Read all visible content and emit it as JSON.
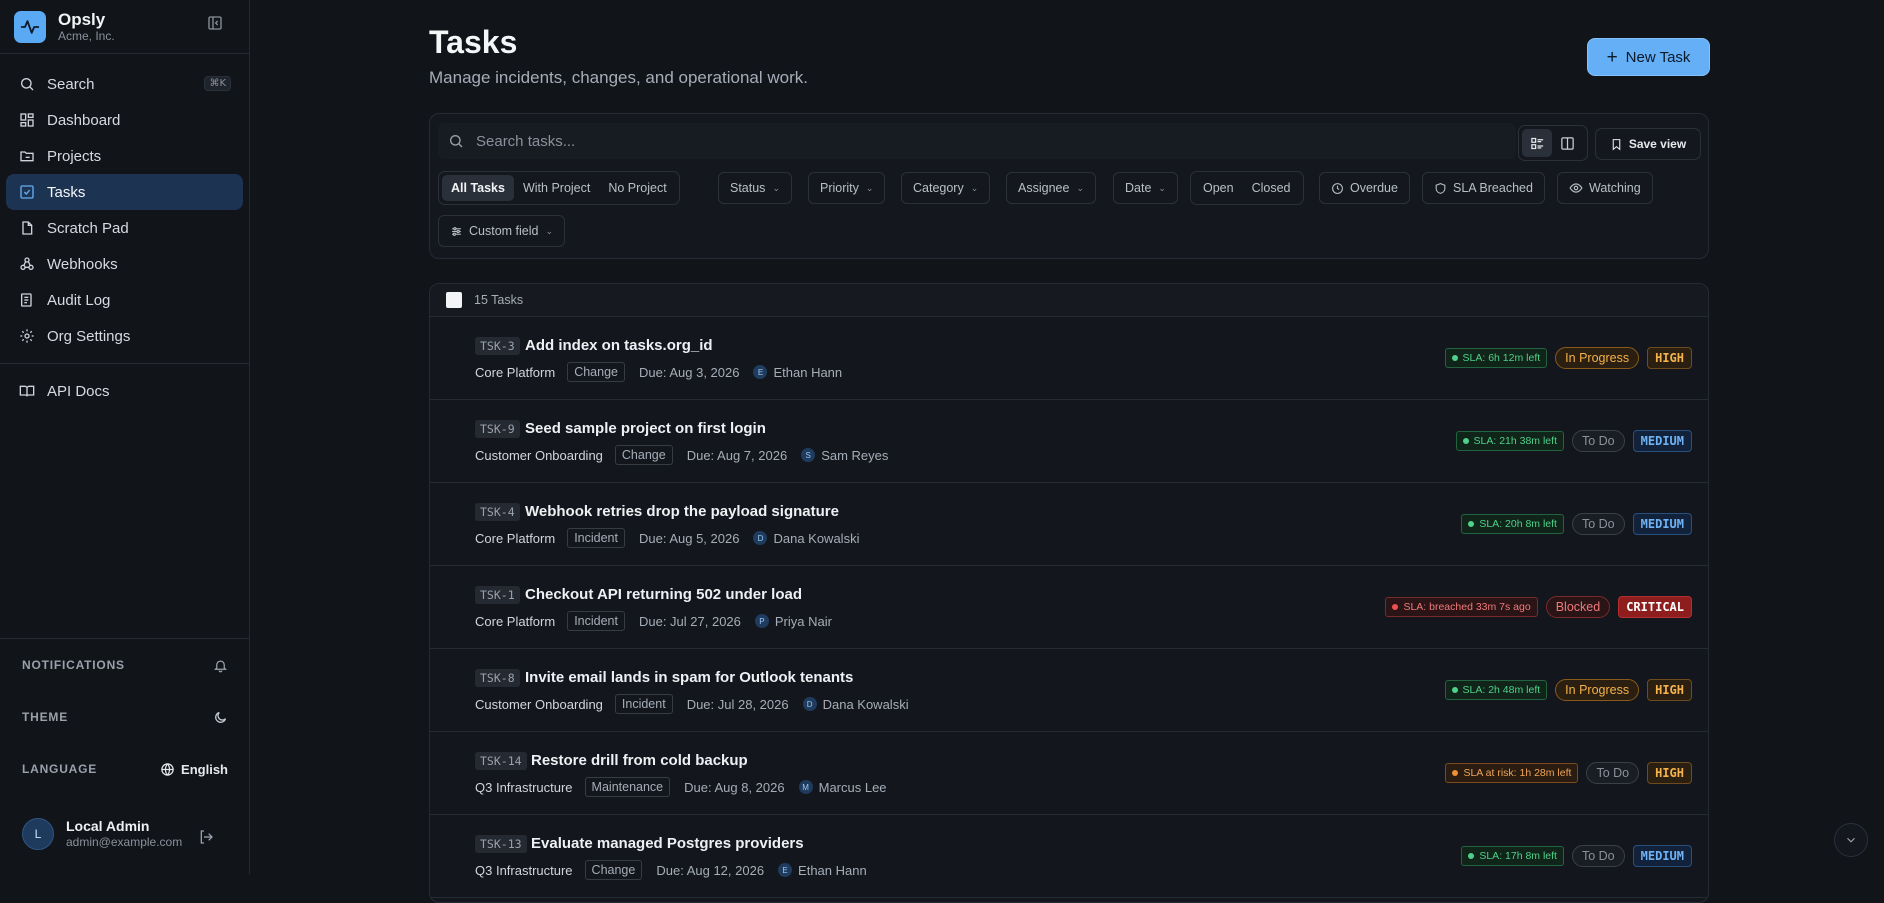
{
  "brand": {
    "name": "Opsly",
    "org": "Acme, Inc."
  },
  "nav": {
    "search": {
      "label": "Search",
      "shortcut": "⌘K"
    },
    "items": [
      {
        "label": "Dashboard",
        "icon": "dashboard-icon"
      },
      {
        "label": "Projects",
        "icon": "folder-icon"
      },
      {
        "label": "Tasks",
        "icon": "tasks-icon",
        "active": true
      },
      {
        "label": "Scratch Pad",
        "icon": "file-icon"
      },
      {
        "label": "Webhooks",
        "icon": "webhook-icon"
      },
      {
        "label": "Audit Log",
        "icon": "audit-log-icon"
      },
      {
        "label": "Org Settings",
        "icon": "gear-icon"
      }
    ],
    "api_docs": "API Docs"
  },
  "sidebar_bottom": {
    "notifications": "NOTIFICATIONS",
    "theme": "THEME",
    "language": "LANGUAGE",
    "language_value": "English"
  },
  "user": {
    "initial": "L",
    "name": "Local Admin",
    "email": "admin@example.com"
  },
  "page": {
    "title": "Tasks",
    "subtitle": "Manage incidents, changes, and operational work.",
    "new_task": "New Task"
  },
  "filters": {
    "search_placeholder": "Search tasks...",
    "save_view": "Save view",
    "scope": [
      "All Tasks",
      "With Project",
      "No Project"
    ],
    "dropdowns": [
      "Status",
      "Priority",
      "Category",
      "Assignee",
      "Date"
    ],
    "state": [
      "Open",
      "Closed"
    ],
    "overdue": "Overdue",
    "sla_breached": "SLA Breached",
    "watching": "Watching",
    "custom_field": "Custom field"
  },
  "list": {
    "count_label": "15 Tasks",
    "tasks": [
      {
        "id": "TSK-3",
        "title": "Add index on tasks.org_id",
        "project": "Core Platform",
        "category": "Change",
        "due": "Due: Aug 3, 2026",
        "assignee_initial": "E",
        "assignee": "Ethan Hann",
        "sla": "SLA: 6h 12m left",
        "sla_kind": "ok",
        "status": "In Progress",
        "status_kind": "prog",
        "priority": "HIGH",
        "priority_kind": "high"
      },
      {
        "id": "TSK-9",
        "title": "Seed sample project on first login",
        "project": "Customer Onboarding",
        "category": "Change",
        "due": "Due: Aug 7, 2026",
        "assignee_initial": "S",
        "assignee": "Sam Reyes",
        "sla": "SLA: 21h 38m left",
        "sla_kind": "ok",
        "status": "To Do",
        "status_kind": "todo",
        "priority": "MEDIUM",
        "priority_kind": "med"
      },
      {
        "id": "TSK-4",
        "title": "Webhook retries drop the payload signature",
        "project": "Core Platform",
        "category": "Incident",
        "due": "Due: Aug 5, 2026",
        "assignee_initial": "D",
        "assignee": "Dana Kowalski",
        "sla": "SLA: 20h 8m left",
        "sla_kind": "ok",
        "status": "To Do",
        "status_kind": "todo",
        "priority": "MEDIUM",
        "priority_kind": "med"
      },
      {
        "id": "TSK-1",
        "title": "Checkout API returning 502 under load",
        "project": "Core Platform",
        "category": "Incident",
        "due": "Due: Jul 27, 2026",
        "assignee_initial": "P",
        "assignee": "Priya Nair",
        "sla": "SLA: breached 33m 7s ago",
        "sla_kind": "bad",
        "status": "Blocked",
        "status_kind": "block",
        "priority": "CRITICAL",
        "priority_kind": "crit"
      },
      {
        "id": "TSK-8",
        "title": "Invite email lands in spam for Outlook tenants",
        "project": "Customer Onboarding",
        "category": "Incident",
        "due": "Due: Jul 28, 2026",
        "assignee_initial": "D",
        "assignee": "Dana Kowalski",
        "sla": "SLA: 2h 48m left",
        "sla_kind": "ok",
        "status": "In Progress",
        "status_kind": "prog",
        "priority": "HIGH",
        "priority_kind": "high"
      },
      {
        "id": "TSK-14",
        "title": "Restore drill from cold backup",
        "project": "Q3 Infrastructure",
        "category": "Maintenance",
        "due": "Due: Aug 8, 2026",
        "assignee_initial": "M",
        "assignee": "Marcus Lee",
        "sla": "SLA at risk: 1h 28m left",
        "sla_kind": "risk",
        "status": "To Do",
        "status_kind": "todo",
        "priority": "HIGH",
        "priority_kind": "high"
      },
      {
        "id": "TSK-13",
        "title": "Evaluate managed Postgres providers",
        "project": "Q3 Infrastructure",
        "category": "Change",
        "due": "Due: Aug 12, 2026",
        "assignee_initial": "E",
        "assignee": "Ethan Hann",
        "sla": "SLA: 17h 8m left",
        "sla_kind": "ok",
        "status": "To Do",
        "status_kind": "todo",
        "priority": "MEDIUM",
        "priority_kind": "med"
      }
    ]
  },
  "colors": {
    "accent": "#64aff6",
    "active_nav": "#1c3352",
    "background": "#111419"
  }
}
